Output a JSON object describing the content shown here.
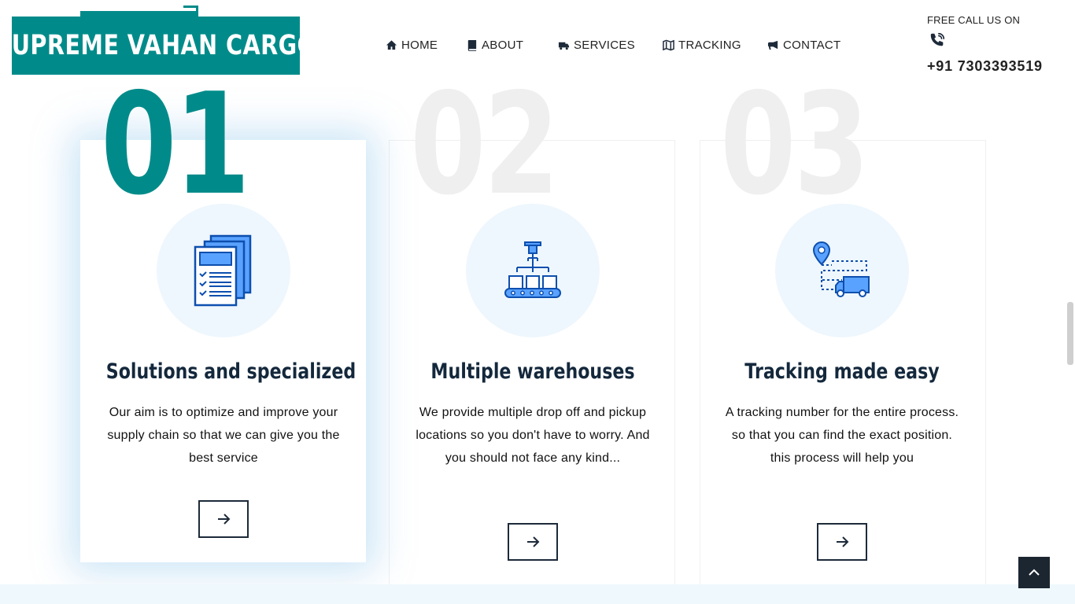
{
  "brand": {
    "name": "SUPREME VAHAN CARGO",
    "color": "#008b8a"
  },
  "nav": {
    "items": [
      {
        "label": "HOME",
        "icon": "home-icon"
      },
      {
        "label": "ABOUT",
        "icon": "book-icon"
      },
      {
        "label": "SERVICES",
        "icon": "truck-icon"
      },
      {
        "label": "TRACKING",
        "icon": "map-icon"
      },
      {
        "label": "CONTACT",
        "icon": "megaphone-icon"
      }
    ]
  },
  "contact": {
    "label": "FREE CALL US ON",
    "icon": "phone-ring-icon",
    "phone": "+91 7303393519"
  },
  "cards": [
    {
      "number": "01",
      "icon": "documents-checklist-icon",
      "title": "Solutions and specialized",
      "description": "Our aim is to optimize and improve your supply chain so that we can give you the best service",
      "active": true
    },
    {
      "number": "02",
      "icon": "conveyor-warehouse-icon",
      "title": "Multiple warehouses",
      "description": "We provide multiple drop off and pickup locations so you don't have to worry. And you should not face any kind...",
      "active": false
    },
    {
      "number": "03",
      "icon": "location-truck-route-icon",
      "title": "Tracking made easy",
      "description": "A tracking number for the entire process. so that you can find the exact position. this process will help you",
      "active": false
    }
  ],
  "colors": {
    "accent": "#008b8a",
    "icon_blue": "#1a6fd8",
    "icon_circle": "#eef7fd",
    "title": "#14283c",
    "faded_number": "#efefef",
    "scroll_top_bg": "#1b2631"
  }
}
